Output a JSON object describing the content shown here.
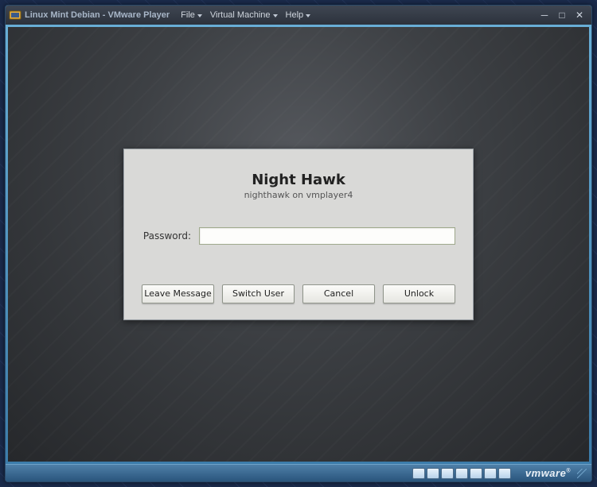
{
  "window": {
    "title": "Linux Mint Debian - VMware Player",
    "menu": {
      "file": "File",
      "vm": "Virtual Machine",
      "help": "Help"
    }
  },
  "lockscreen": {
    "user_display": "Night Hawk",
    "subtitle": "nighthawk on vmplayer4",
    "password_label": "Password:",
    "password_value": "",
    "buttons": {
      "leave_message": "Leave Message",
      "switch_user": "Switch User",
      "cancel": "Cancel",
      "unlock": "Unlock"
    }
  },
  "statusbar": {
    "brand": "vmware"
  }
}
